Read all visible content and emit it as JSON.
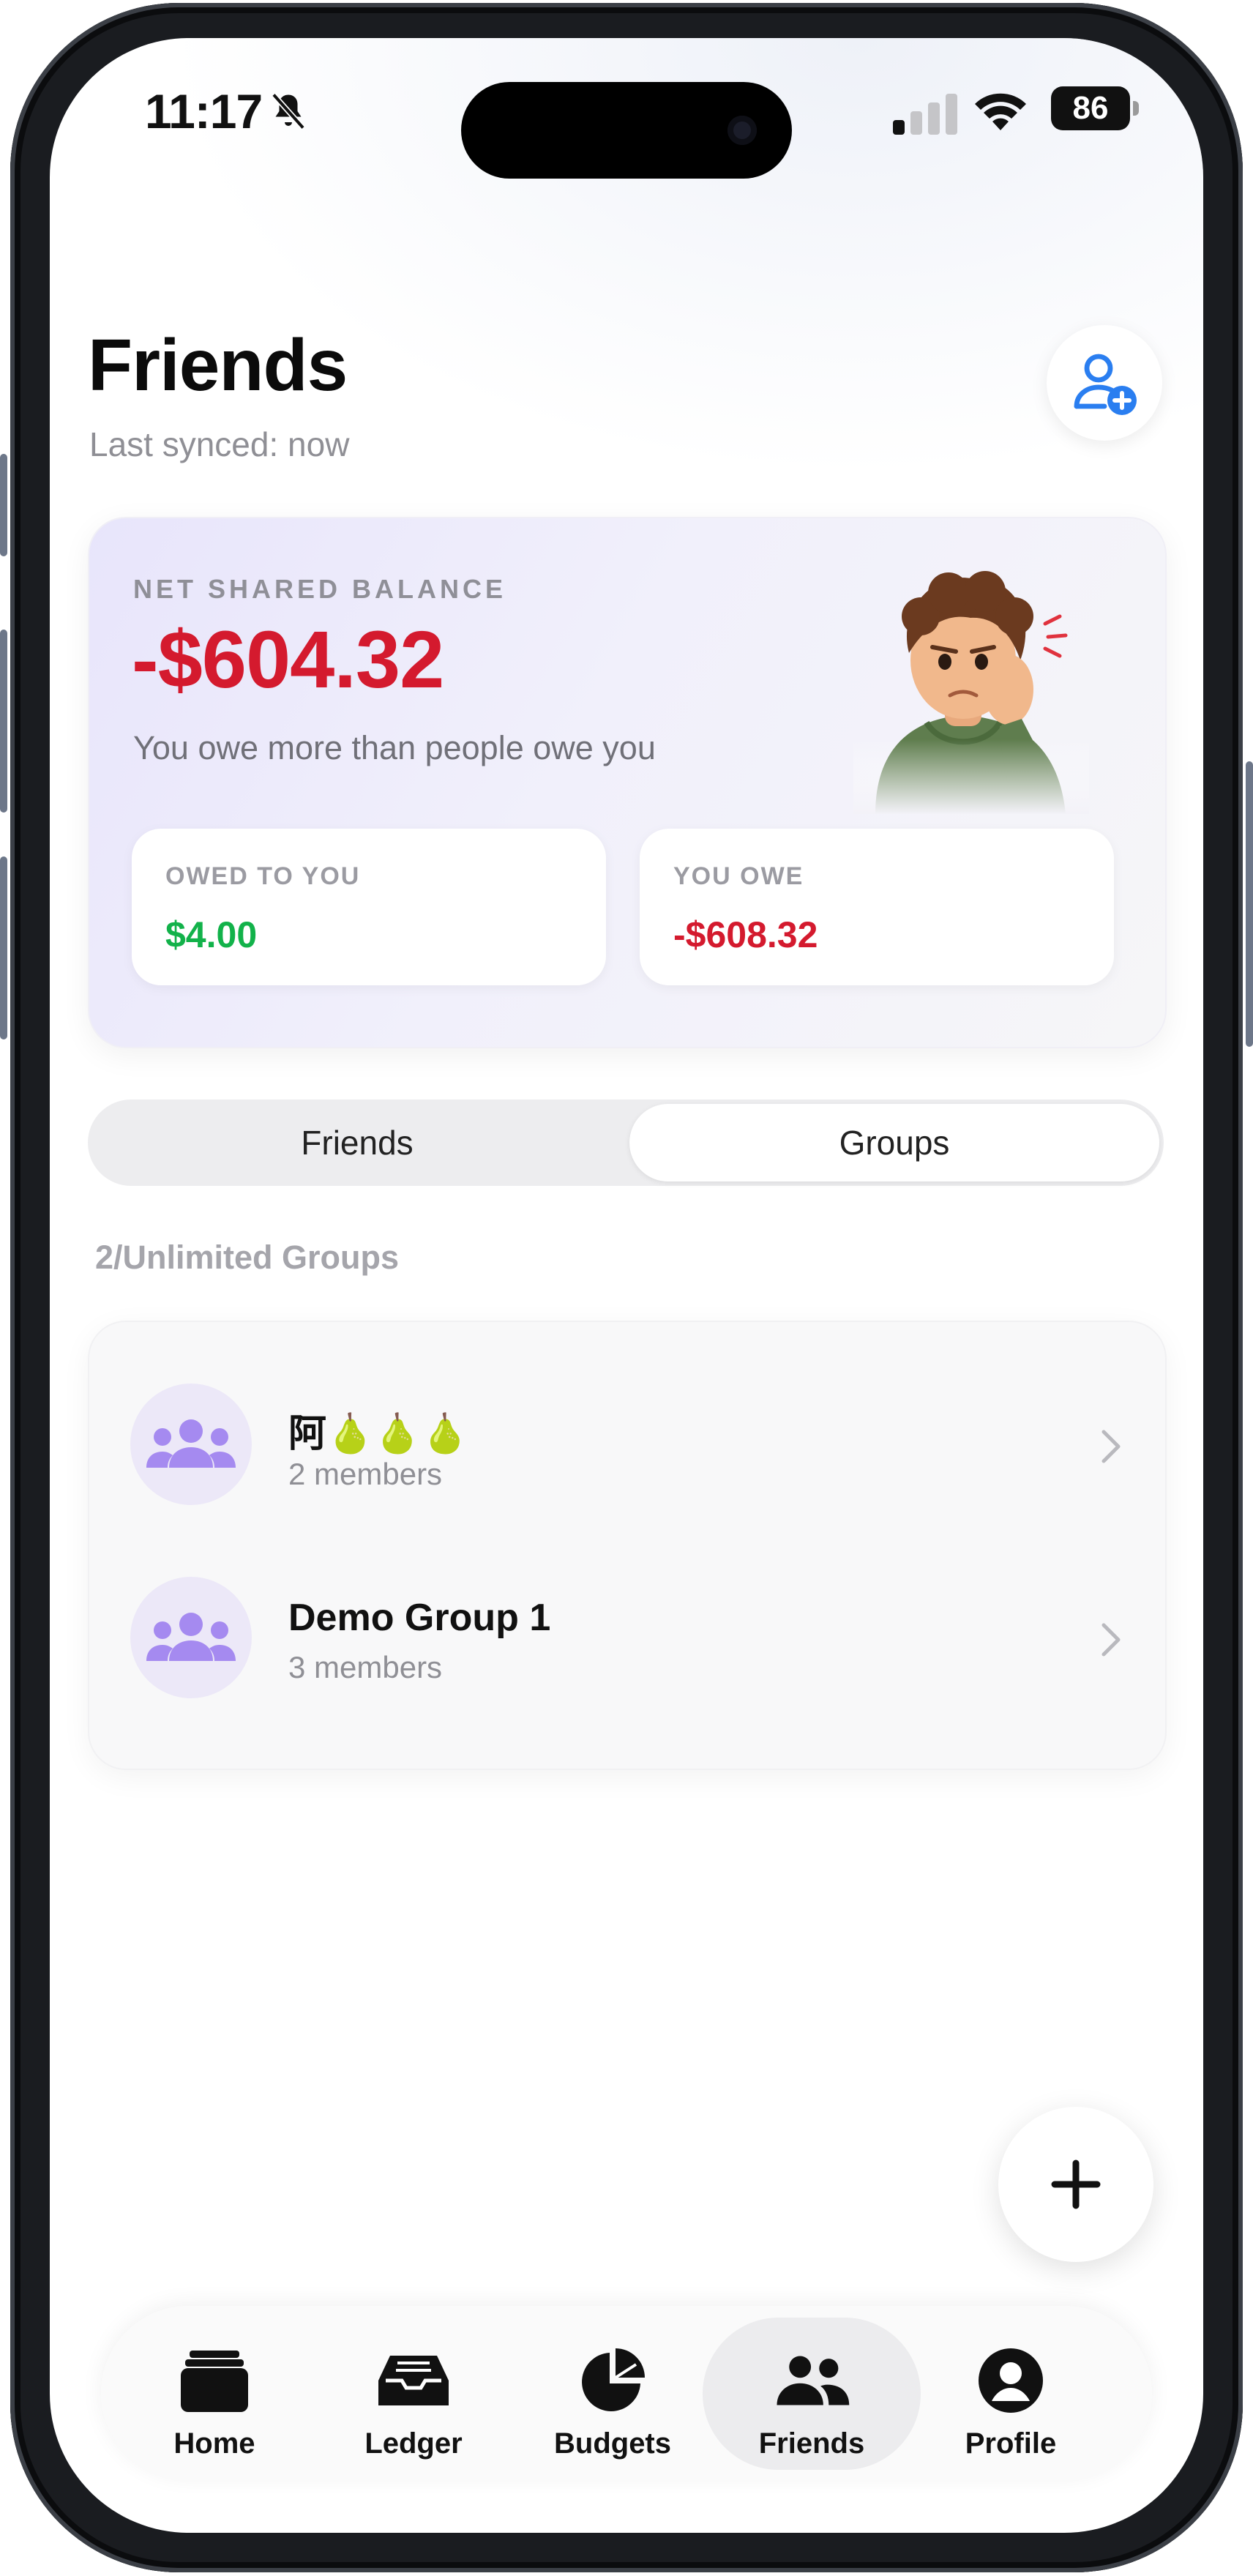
{
  "status_bar": {
    "time": "11:17",
    "battery": "86"
  },
  "header": {
    "title": "Friends",
    "subtitle": "Last synced: now"
  },
  "balance_card": {
    "label": "NET SHARED BALANCE",
    "amount": "-$604.32",
    "description": "You owe more than people owe you",
    "owed_to_you": {
      "label": "OWED TO YOU",
      "value": "$4.00"
    },
    "you_owe": {
      "label": "YOU OWE",
      "value": "-$608.32"
    },
    "colors": {
      "negative": "#d41a2e",
      "positive": "#12b24a"
    }
  },
  "segmented": {
    "options": [
      "Friends",
      "Groups"
    ],
    "selected": "Groups"
  },
  "groups_count": "2/Unlimited Groups",
  "groups": [
    {
      "name": "阿🍐🍐🍐",
      "members": "2 members"
    },
    {
      "name": "Demo Group 1",
      "members": "3 members"
    }
  ],
  "tabs": [
    {
      "label": "Home",
      "icon": "folder-icon"
    },
    {
      "label": "Ledger",
      "icon": "inbox-tray-icon"
    },
    {
      "label": "Budgets",
      "icon": "pie-chart-icon"
    },
    {
      "label": "Friends",
      "icon": "people-icon",
      "active": true
    },
    {
      "label": "Profile",
      "icon": "person-circle-icon"
    }
  ],
  "accent_colors": {
    "group_icon": "#a58af0",
    "add_friend_icon": "#2a7ef0"
  }
}
